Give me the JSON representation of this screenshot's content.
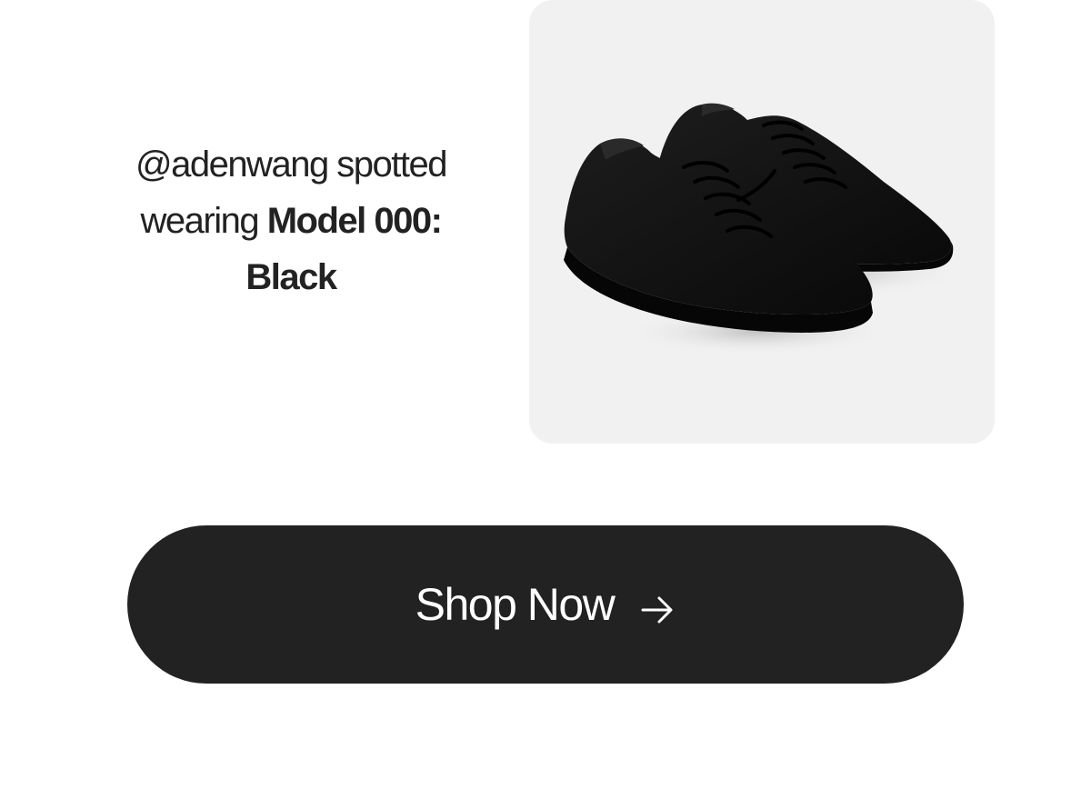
{
  "caption": {
    "prefix": "@adenwang spotted",
    "middle": "wearing ",
    "product_name": "Model 000:",
    "color_name": "Black"
  },
  "product_image": {
    "icon": "sneaker-pair-image",
    "background_color": "#f1f1f1",
    "shoe_color": "#111111"
  },
  "cta": {
    "label": "Shop Now",
    "icon": "arrow-right-icon",
    "background_color": "#222222",
    "text_color": "#ffffff"
  }
}
